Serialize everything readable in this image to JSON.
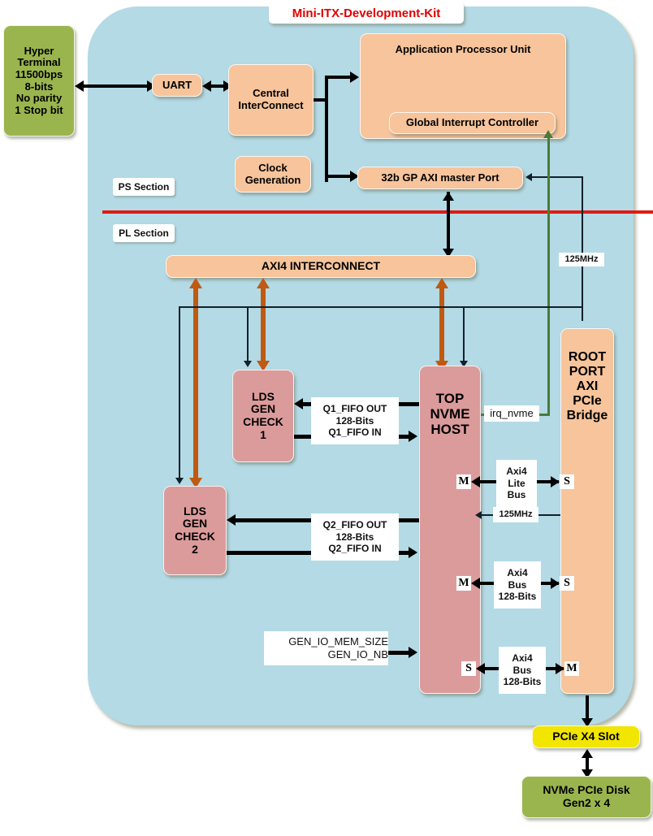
{
  "diagram": {
    "title": "Mini-ITX-Development-Kit",
    "sections": {
      "ps_label": "PS Section",
      "pl_label": "PL Section"
    }
  },
  "blocks": {
    "hyper_terminal": "Hyper\nTerminal\n11500bps\n8-bits\nNo parity\n1 Stop bit",
    "hyper_terminal_lines": [
      "Hyper",
      "Terminal",
      "11500bps",
      "8-bits",
      "No parity",
      "1 Stop bit"
    ],
    "uart": "UART",
    "central_interconnect": "Central\nInterConnect",
    "central_interconnect_lines": [
      "Central",
      "InterConnect"
    ],
    "apu": "Application Processor Unit",
    "gic": "Global Interrupt Controller",
    "clock_generation_lines": [
      "Clock",
      "Generation"
    ],
    "gp_axi_port": "32b GP AXI master Port",
    "axi4_interconnect": "AXI4 INTERCONNECT",
    "lds_gen_check_1_lines": [
      "LDS",
      "GEN",
      "CHECK",
      "1"
    ],
    "lds_gen_check_2_lines": [
      "LDS",
      "GEN",
      "CHECK",
      "2"
    ],
    "top_nvme_host_lines": [
      "TOP",
      "NVME",
      "HOST"
    ],
    "root_port_bridge_lines": [
      "ROOT",
      "PORT",
      "AXI",
      "PCIe",
      "Bridge"
    ],
    "pcie_slot": "PCIe X4 Slot",
    "nvme_disk_lines": [
      "NVMe PCIe Disk",
      "Gen2 x 4"
    ]
  },
  "labels": {
    "q1_fifo": [
      "Q1_FIFO OUT",
      "128-Bits",
      "Q1_FIFO IN"
    ],
    "q2_fifo": [
      "Q2_FIFO OUT",
      "128-Bits",
      "Q2_FIFO IN"
    ],
    "gen_io": [
      "GEN_IO_MEM_SIZE",
      "GEN_IO_NB"
    ],
    "irq_nvme": "irq_nvme",
    "clock_125_top": "125MHz",
    "clock_125_mid": "125MHz",
    "axi4_lite_bus": [
      "Axi4",
      "Lite",
      "Bus"
    ],
    "axi4_bus_mid": [
      "Axi4",
      "Bus",
      "128-Bits"
    ],
    "axi4_bus_low": [
      "Axi4",
      "Bus",
      "128-Bits"
    ],
    "master": "M",
    "slave": "S"
  },
  "colors": {
    "board": "#b3dae5",
    "orange_block": "#f7c49b",
    "rose_block": "#dc9b9b",
    "green_block": "#9bb54e",
    "yellow_block": "#f2e500",
    "section_divider": "#e01b12",
    "title_text": "#e00000",
    "clock_arrow": "#c05a12",
    "irq_line": "#4c7a38"
  }
}
